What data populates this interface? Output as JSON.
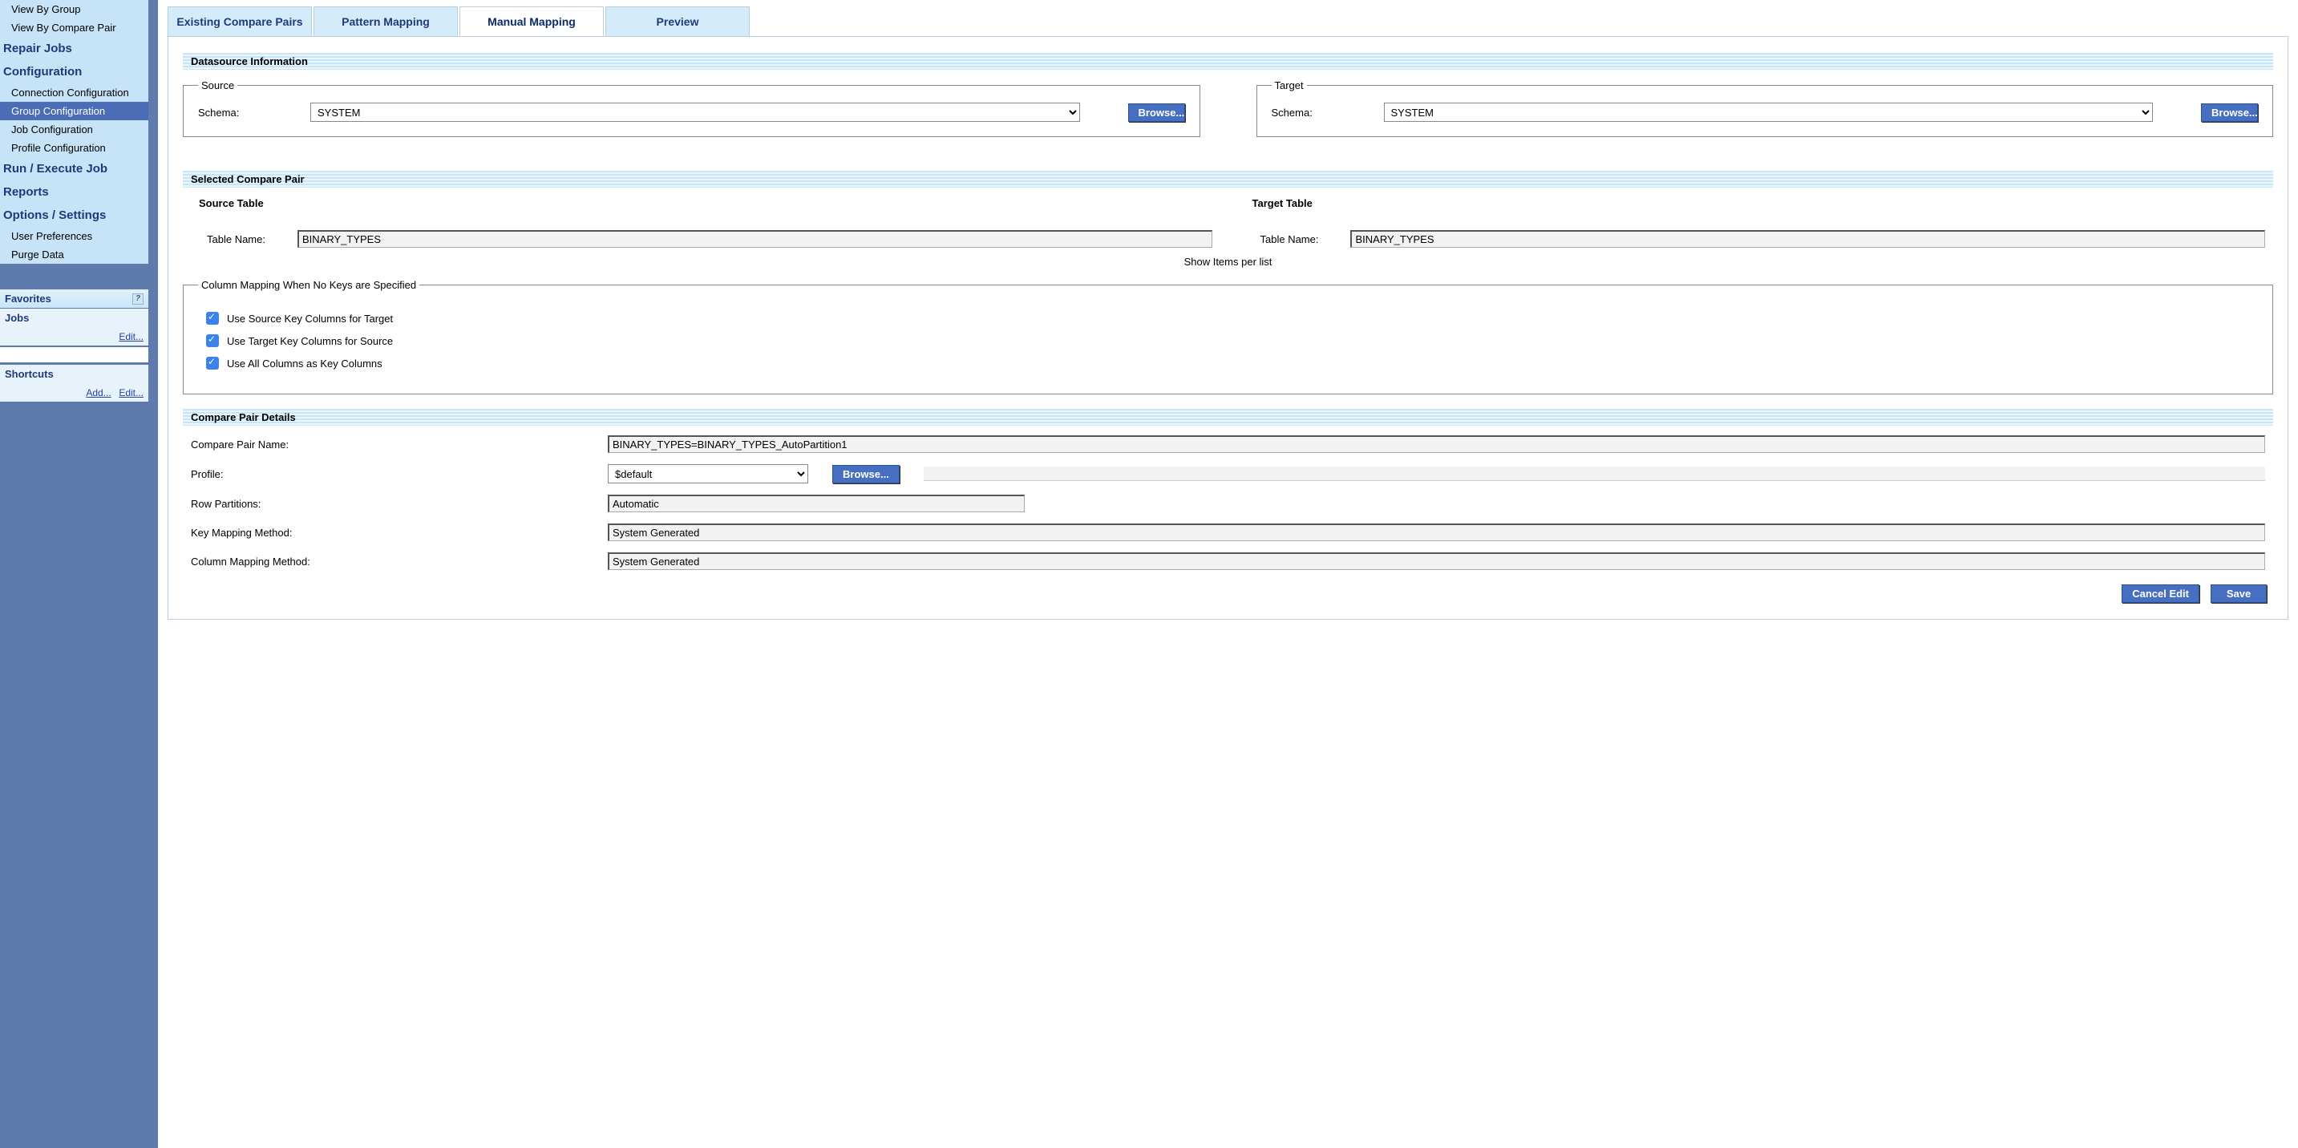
{
  "sidebar": {
    "top_items": [
      "View By Group",
      "View By Compare Pair"
    ],
    "repair_jobs": "Repair Jobs",
    "configuration": "Configuration",
    "config_items": [
      "Connection Configuration",
      "Group Configuration",
      "Job Configuration",
      "Profile Configuration"
    ],
    "config_selected_index": 1,
    "run_execute": "Run / Execute Job",
    "reports": "Reports",
    "options": "Options / Settings",
    "options_items": [
      "User Preferences",
      "Purge Data"
    ],
    "favorites_heading": "Favorites",
    "jobs_heading": "Jobs",
    "edit_link": "Edit...",
    "shortcuts_heading": "Shortcuts",
    "add_link": "Add...",
    "edit_link2": "Edit..."
  },
  "tabs": [
    "Existing Compare Pairs",
    "Pattern Mapping",
    "Manual Mapping",
    "Preview"
  ],
  "active_tab_index": 2,
  "datasource": {
    "heading": "Datasource Information",
    "source_legend": "Source",
    "target_legend": "Target",
    "schema_label": "Schema:",
    "source_schema": "SYSTEM",
    "target_schema": "SYSTEM",
    "browse_label": "Browse..."
  },
  "compare_pair": {
    "heading": "Selected Compare Pair",
    "source_table_heading": "Source Table",
    "target_table_heading": "Target Table",
    "table_name_label": "Table Name:",
    "source_table": "BINARY_TYPES",
    "target_table": "BINARY_TYPES",
    "show_items": "Show Items per list",
    "col_mapping_legend": "Column Mapping When No Keys are Specified",
    "cbx1": "Use Source Key Columns for Target",
    "cbx2": "Use Target Key Columns for Source",
    "cbx3": "Use All Columns as Key Columns"
  },
  "details": {
    "heading": "Compare Pair Details",
    "name_label": "Compare Pair Name:",
    "name_value": "BINARY_TYPES=BINARY_TYPES_AutoPartition1",
    "profile_label": "Profile:",
    "profile_value": "$default",
    "browse_label": "Browse...",
    "row_part_label": "Row Partitions:",
    "row_part_value": "Automatic",
    "key_map_label": "Key Mapping Method:",
    "key_map_value": "System Generated",
    "col_map_label": "Column Mapping Method:",
    "col_map_value": "System Generated"
  },
  "buttons": {
    "cancel": "Cancel Edit",
    "save": "Save"
  }
}
